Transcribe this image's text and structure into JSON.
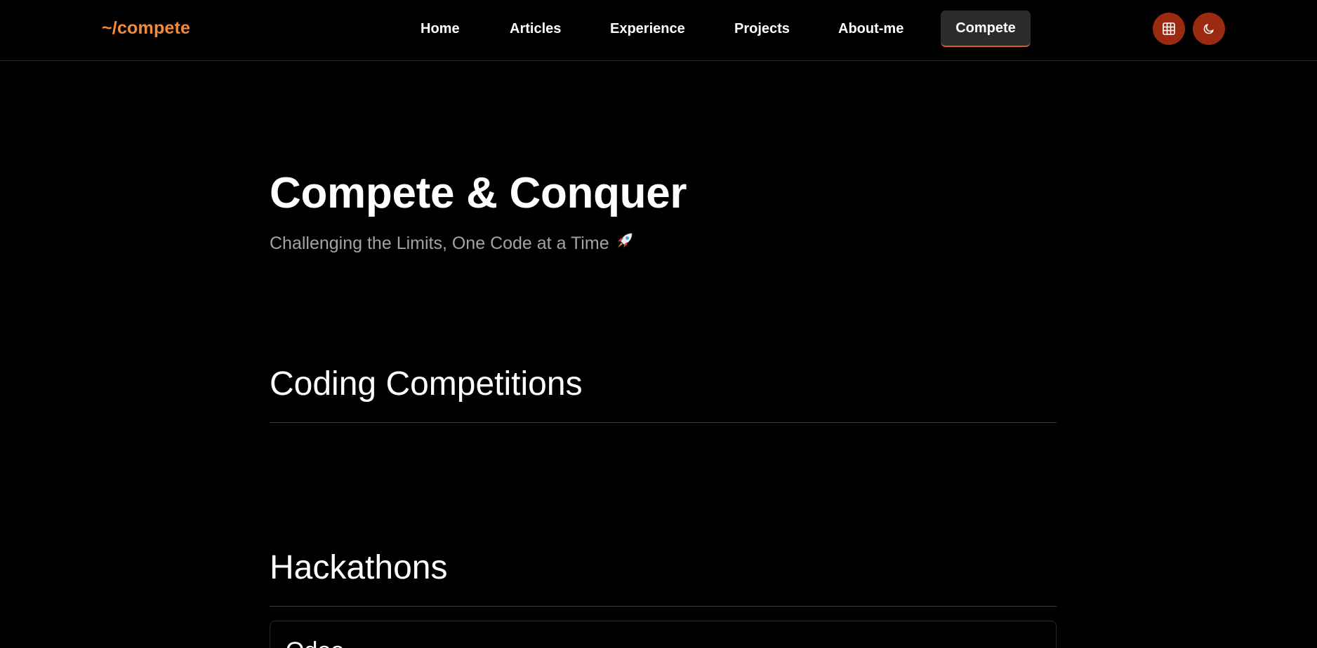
{
  "nav": {
    "logo": "~/compete",
    "links": [
      {
        "label": "Home"
      },
      {
        "label": "Articles"
      },
      {
        "label": "Experience"
      },
      {
        "label": "Projects"
      },
      {
        "label": "About-me"
      },
      {
        "label": "Compete"
      }
    ],
    "active_link": "Compete",
    "icons": [
      "grid-icon",
      "moon-icon"
    ]
  },
  "hero": {
    "title": "Compete & Conquer",
    "subtitle": "Challenging the Limits, One Code at a Time"
  },
  "sections": {
    "coding": {
      "title": "Coding Competitions"
    },
    "hackathons": {
      "title": "Hackathons",
      "first_card_title": "Odoo"
    }
  },
  "colors": {
    "background": "#000000",
    "accent": "#f28b3c",
    "icon_button": "#9a2a12",
    "active_underline": "#e0573f"
  }
}
